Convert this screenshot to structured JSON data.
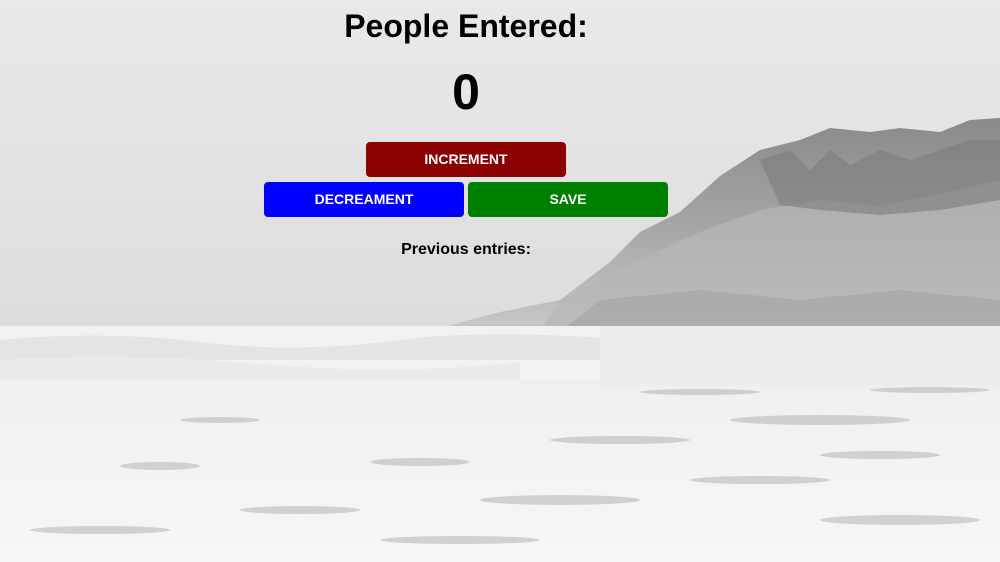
{
  "page": {
    "title": "People Entered:",
    "count": "0",
    "previous_label": "Previous entries:"
  },
  "buttons": {
    "increment": {
      "label": "INCREMENT",
      "color": "#8b0000"
    },
    "decrement": {
      "label": "DECREAMENT",
      "color": "#0000ff"
    },
    "save": {
      "label": "SAVE",
      "color": "#008000"
    }
  },
  "background": {
    "description_icon": "beach-mountain-photo"
  }
}
